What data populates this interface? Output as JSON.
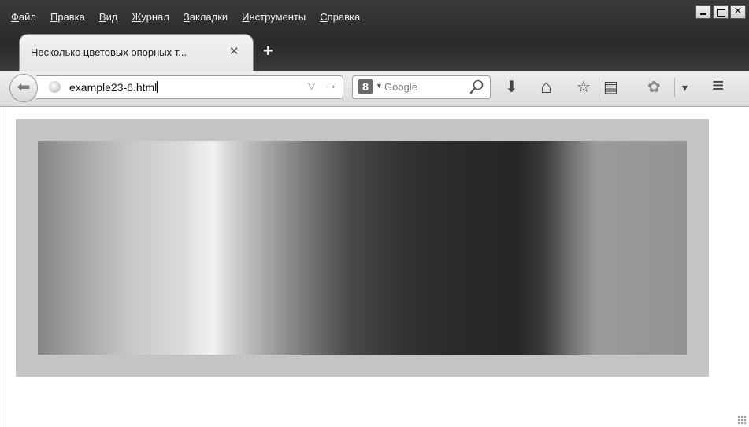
{
  "menu": {
    "items": [
      {
        "underline": "Ф",
        "rest": "айл"
      },
      {
        "underline": "П",
        "rest": "равка"
      },
      {
        "underline": "В",
        "rest": "ид"
      },
      {
        "underline": "Ж",
        "rest": "урнал"
      },
      {
        "underline": "З",
        "rest": "акладки"
      },
      {
        "underline": "И",
        "rest": "нструменты"
      },
      {
        "underline": "С",
        "rest": "правка"
      }
    ]
  },
  "window_controls": {
    "close_glyph": "✕"
  },
  "tab": {
    "title": "Несколько цветовых опорных т...",
    "close_glyph": "✕"
  },
  "new_tab": {
    "glyph": "+"
  },
  "toolbar": {
    "back_glyph": "⬅",
    "url": "example23-6.html",
    "dropdown_glyph": "▽",
    "go_glyph": "→",
    "search_engine_glyph": "8",
    "search_engine_caret": "▼",
    "search_placeholder": "Google",
    "download_glyph": "⬇",
    "home_glyph": "⌂",
    "bookmark_glyph": "☆",
    "bookmarks_menu_glyph": "▤",
    "addon_glyph": "✿",
    "overflow_glyph": "▾",
    "menu_glyph": "≡"
  },
  "icons": {
    "back": "back-arrow-icon",
    "globe": "globe-icon",
    "search_engine": "google-icon",
    "magnifier": "magnifier-icon",
    "download": "download-icon",
    "home": "home-icon",
    "bookmark": "bookmark-star-icon",
    "bookmarks_menu": "bookmarks-menu-icon",
    "addon": "addon-icon",
    "menu": "hamburger-menu-icon"
  },
  "colors": {
    "title_bar": "#2e2e2e",
    "demo_box": "#c4c4c4",
    "gradient_stops": [
      "#858585",
      "#f2f2f2",
      "#262626",
      "#949494"
    ]
  }
}
